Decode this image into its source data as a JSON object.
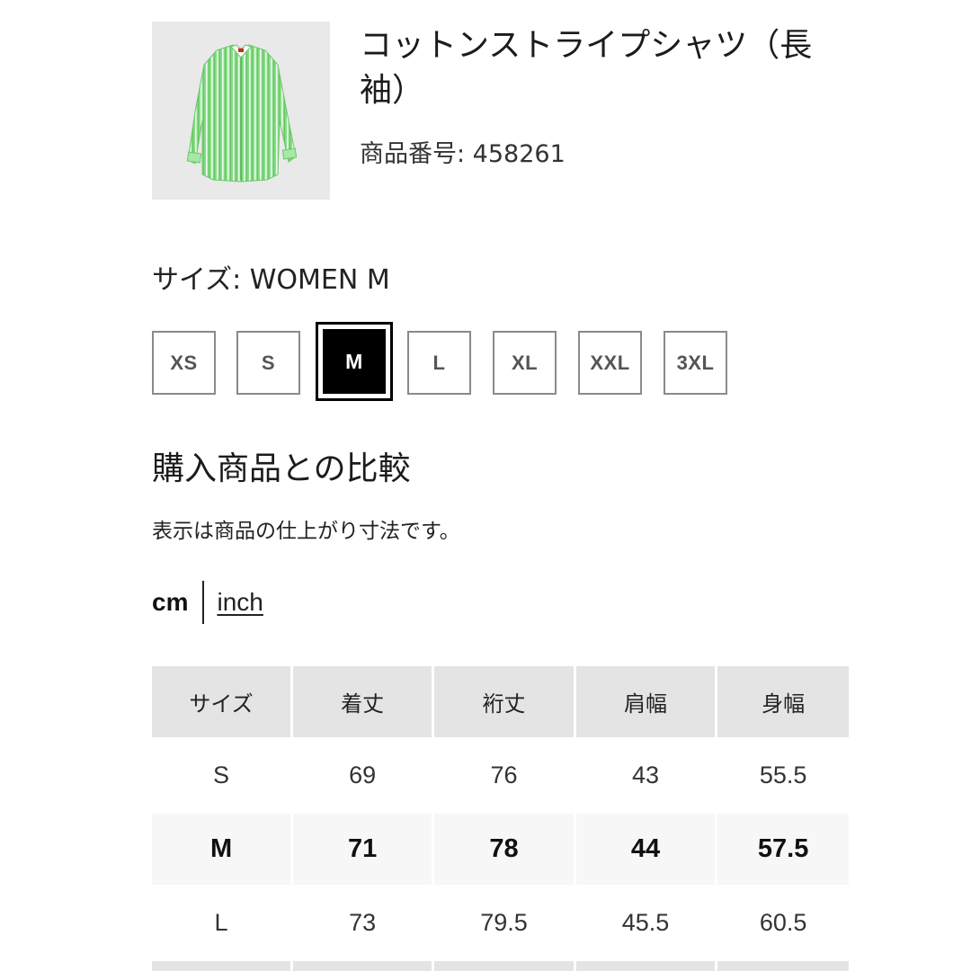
{
  "product": {
    "title": "コットンストライプシャツ（長袖）",
    "code_label": "商品番号: 458261",
    "image_color": "#7fd67f"
  },
  "size_selector": {
    "label": "サイズ: WOMEN M",
    "options": [
      "XS",
      "S",
      "M",
      "L",
      "XL",
      "XXL",
      "3XL"
    ],
    "selected": "M"
  },
  "compare": {
    "title": "購入商品との比較",
    "note": "表示は商品の仕上がり寸法です。"
  },
  "units": {
    "active": "cm",
    "inactive": "inch"
  },
  "table": {
    "headers": [
      "サイズ",
      "着丈",
      "裄丈",
      "肩幅",
      "身幅"
    ],
    "rows": [
      [
        "S",
        "69",
        "76",
        "43",
        "55.5"
      ],
      [
        "M",
        "71",
        "78",
        "44",
        "57.5"
      ],
      [
        "L",
        "73",
        "79.5",
        "45.5",
        "60.5"
      ]
    ],
    "highlight_row": 1
  }
}
